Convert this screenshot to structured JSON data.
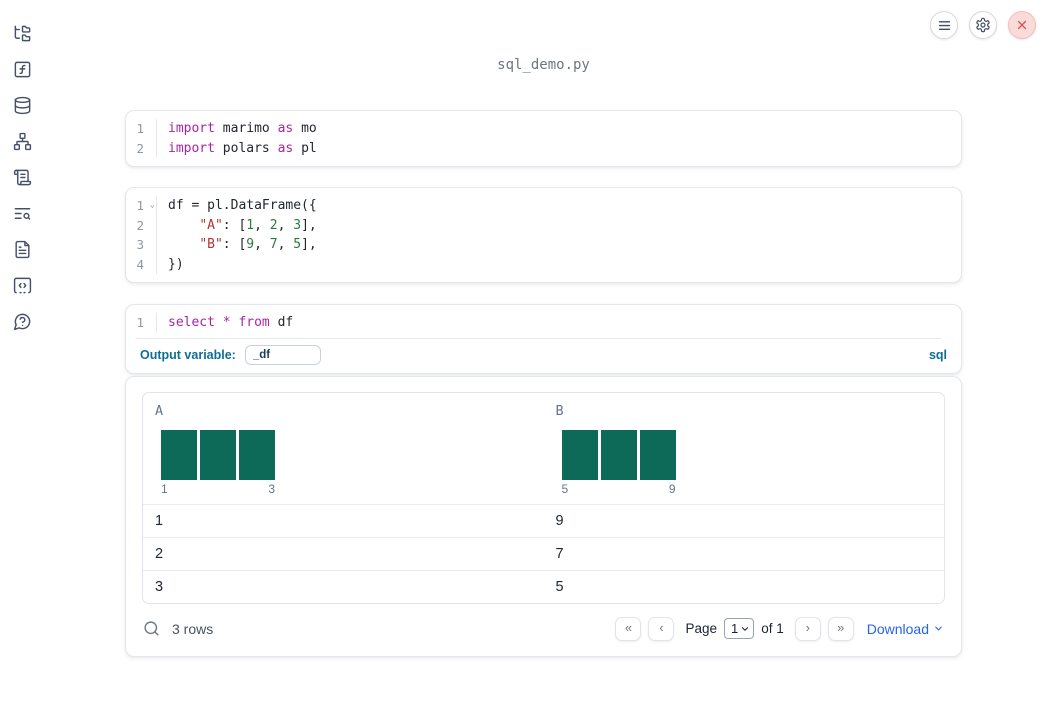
{
  "app": {
    "title": "sql_demo.py"
  },
  "topbar": {
    "buttons": [
      {
        "icon": "hamburger-icon"
      },
      {
        "icon": "gear-icon"
      },
      {
        "icon": "close-icon"
      }
    ]
  },
  "sidebar": {
    "items": [
      {
        "icon": "folder-tree-icon"
      },
      {
        "icon": "function-square-icon"
      },
      {
        "icon": "database-icon"
      },
      {
        "icon": "network-icon"
      },
      {
        "icon": "scroll-text-icon"
      },
      {
        "icon": "text-search-icon"
      },
      {
        "icon": "file-text-icon"
      },
      {
        "icon": "code-square-icon"
      },
      {
        "icon": "help-bubble-icon"
      }
    ]
  },
  "cells": [
    {
      "lines": [
        {
          "num": "1",
          "tokens": [
            [
              "import",
              "kw"
            ],
            [
              " marimo ",
              "pl"
            ],
            [
              "as",
              "kw"
            ],
            [
              " mo",
              "pl"
            ]
          ]
        },
        {
          "num": "2",
          "tokens": [
            [
              "import",
              "kw"
            ],
            [
              " polars ",
              "pl"
            ],
            [
              "as",
              "kw"
            ],
            [
              " pl",
              "pl"
            ]
          ]
        }
      ]
    },
    {
      "lines": [
        {
          "num": "1",
          "fold": true,
          "tokens": [
            [
              "df = pl.DataFrame({",
              "pl"
            ]
          ]
        },
        {
          "num": "2",
          "tokens": [
            [
              "    ",
              "pl"
            ],
            [
              "\"A\"",
              "str"
            ],
            [
              ": [",
              "pl"
            ],
            [
              "1",
              "num"
            ],
            [
              ", ",
              "pl"
            ],
            [
              "2",
              "num"
            ],
            [
              ", ",
              "pl"
            ],
            [
              "3",
              "num"
            ],
            [
              "],",
              "pl"
            ]
          ]
        },
        {
          "num": "3",
          "tokens": [
            [
              "    ",
              "pl"
            ],
            [
              "\"B\"",
              "str"
            ],
            [
              ": [",
              "pl"
            ],
            [
              "9",
              "num"
            ],
            [
              ", ",
              "pl"
            ],
            [
              "7",
              "num"
            ],
            [
              ", ",
              "pl"
            ],
            [
              "5",
              "num"
            ],
            [
              "],",
              "pl"
            ]
          ]
        },
        {
          "num": "4",
          "tokens": [
            [
              "})",
              "pl"
            ]
          ]
        }
      ]
    },
    {
      "lines": [
        {
          "num": "1",
          "tokens": [
            [
              "select",
              "kw"
            ],
            [
              " ",
              "pl"
            ],
            [
              "*",
              "kw"
            ],
            [
              " ",
              "pl"
            ],
            [
              "from",
              "kw"
            ],
            [
              " df",
              "pl"
            ]
          ]
        }
      ]
    }
  ],
  "sql_cell": {
    "output_variable_label": "Output variable:",
    "output_variable_value": "_df",
    "language_badge": "sql"
  },
  "table": {
    "columns": [
      {
        "name": "A",
        "hist": {
          "bars": [
            1,
            1,
            1
          ],
          "min_label": "1",
          "max_label": "3"
        }
      },
      {
        "name": "B",
        "hist": {
          "bars": [
            1,
            1,
            1
          ],
          "min_label": "5",
          "max_label": "9"
        }
      }
    ],
    "rows": [
      [
        "1",
        "9"
      ],
      [
        "2",
        "7"
      ],
      [
        "3",
        "5"
      ]
    ],
    "footer": {
      "row_count": "3 rows",
      "pagination": {
        "first": "«",
        "prev": "‹",
        "page_label": "Page",
        "page_value": "1",
        "of_label": "of 1",
        "next": "›",
        "last": "»"
      },
      "download_label": "Download"
    }
  },
  "colors": {
    "keyword": "#a626a4",
    "string": "#b03434",
    "number": "#2b7a3d",
    "code_text": "#22272e",
    "hist_bar": "#0e6a58",
    "sql_accent": "#0e6f94",
    "download_link": "#2563eb",
    "close_red": "#dd4f4f",
    "icon_color": "#44506a"
  }
}
